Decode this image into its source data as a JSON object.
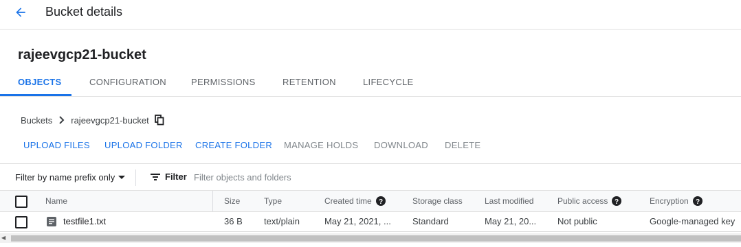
{
  "header": {
    "title": "Bucket details"
  },
  "bucket": {
    "name": "rajeevgcp21-bucket"
  },
  "tabs": [
    {
      "label": "OBJECTS",
      "active": true
    },
    {
      "label": "CONFIGURATION",
      "active": false
    },
    {
      "label": "PERMISSIONS",
      "active": false
    },
    {
      "label": "RETENTION",
      "active": false
    },
    {
      "label": "LIFECYCLE",
      "active": false
    }
  ],
  "breadcrumb": {
    "root": "Buckets",
    "current": "rajeevgcp21-bucket"
  },
  "actions": {
    "upload_files": "UPLOAD FILES",
    "upload_folder": "UPLOAD FOLDER",
    "create_folder": "CREATE FOLDER",
    "manage_holds": "MANAGE HOLDS",
    "download": "DOWNLOAD",
    "delete": "DELETE"
  },
  "filter": {
    "prefix_option": "Filter by name prefix only",
    "label": "Filter",
    "placeholder": "Filter objects and folders"
  },
  "table": {
    "columns": {
      "name": "Name",
      "size": "Size",
      "type": "Type",
      "created": "Created time",
      "storage": "Storage class",
      "modified": "Last modified",
      "public": "Public access",
      "encryption": "Encryption"
    },
    "rows": [
      {
        "name": "testfile1.txt",
        "size": "36 B",
        "type": "text/plain",
        "created": "May 21, 2021, ...",
        "storage": "Standard",
        "modified": "May 21, 20...",
        "public": "Not public",
        "encryption": "Google-managed key"
      }
    ]
  },
  "colors": {
    "accent": "#1a73e8",
    "text": "#202124",
    "muted": "#5f6368"
  }
}
